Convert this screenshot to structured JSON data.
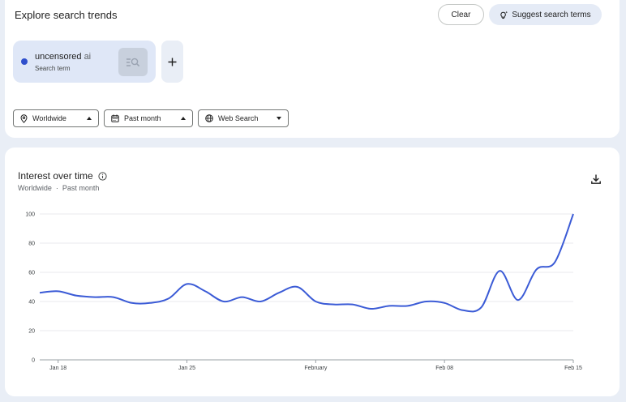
{
  "header": {
    "title": "Explore search trends",
    "clear_label": "Clear",
    "suggest_label": "Suggest search terms"
  },
  "term": {
    "name": "uncensored",
    "name_suffix": "ai",
    "sublabel": "Search term",
    "color": "#2f4fcc"
  },
  "filters": {
    "geo": "Worldwide",
    "time": "Past month",
    "property": "Web Search"
  },
  "chart_section": {
    "title": "Interest over time",
    "geo": "Worldwide",
    "separator": "·",
    "range": "Past month"
  },
  "icons": {
    "suggest": "sparkle-bulb-icon",
    "search": "search-list-icon",
    "add": "plus-icon",
    "location": "location-pin-icon",
    "calendar": "calendar-icon",
    "globe": "globe-icon",
    "info": "info-icon",
    "download": "download-icon"
  },
  "chart_data": {
    "type": "line",
    "title": "Interest over time",
    "xlabel": "",
    "ylabel": "",
    "ylim": [
      0,
      100
    ],
    "yticks": [
      0,
      20,
      40,
      60,
      80,
      100
    ],
    "xtick_labels": [
      {
        "label": "Jan 18",
        "day": 1
      },
      {
        "label": "Jan 25",
        "day": 8
      },
      {
        "label": "February",
        "day": 15
      },
      {
        "label": "Feb 08",
        "day": 22
      },
      {
        "label": "Feb 15",
        "day": 29
      }
    ],
    "grid": true,
    "series": [
      {
        "name": "uncensored ai",
        "color": "#3b5bd6",
        "points": [
          [
            0,
            46
          ],
          [
            1,
            47
          ],
          [
            2,
            44
          ],
          [
            3,
            43
          ],
          [
            4,
            43
          ],
          [
            5,
            39
          ],
          [
            6,
            39
          ],
          [
            7,
            42
          ],
          [
            8,
            52
          ],
          [
            9,
            47
          ],
          [
            10,
            40
          ],
          [
            11,
            43
          ],
          [
            12,
            40
          ],
          [
            13,
            46
          ],
          [
            14,
            50
          ],
          [
            15,
            40
          ],
          [
            16,
            38
          ],
          [
            17,
            38
          ],
          [
            18,
            35
          ],
          [
            19,
            37
          ],
          [
            20,
            37
          ],
          [
            21,
            40
          ],
          [
            22,
            39
          ],
          [
            23,
            34
          ],
          [
            24,
            36
          ],
          [
            25,
            61
          ],
          [
            26,
            41
          ],
          [
            27,
            62
          ],
          [
            28,
            67
          ],
          [
            29,
            100
          ]
        ]
      }
    ]
  }
}
